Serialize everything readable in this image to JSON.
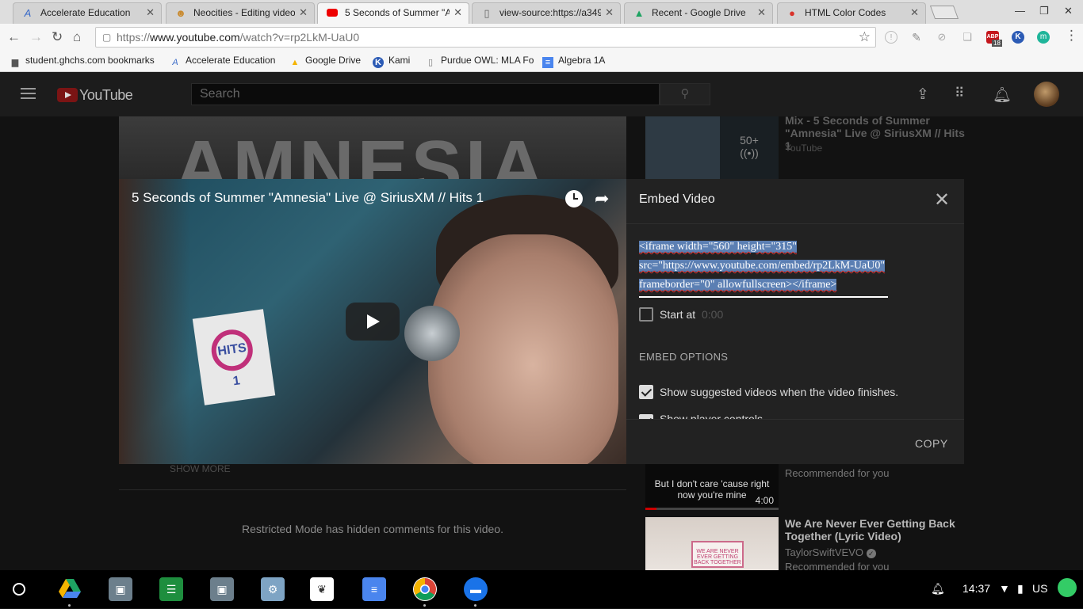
{
  "browser": {
    "tabs": [
      {
        "label": "Accelerate Education",
        "icon": "accelerate-icon",
        "active": false
      },
      {
        "label": "Neocities - Editing video",
        "icon": "cat-icon",
        "active": false
      },
      {
        "label": "5 Seconds of Summer \"A",
        "icon": "youtube-icon",
        "active": true
      },
      {
        "label": "view-source:https://a349",
        "icon": "page-icon",
        "active": false
      },
      {
        "label": "Recent - Google Drive",
        "icon": "drive-icon",
        "active": false
      },
      {
        "label": "HTML Color Codes",
        "icon": "color-codes-icon",
        "active": false
      }
    ],
    "url_prefix": "https://",
    "url_host": "www.youtube.com",
    "url_path": "/watch?v=rp2LkM-UaU0",
    "abp_count": "18",
    "bookmarks": [
      {
        "label": "student.ghchs.com bookmarks",
        "icon": "folder-icon"
      },
      {
        "label": "Accelerate Education",
        "icon": "accelerate-icon"
      },
      {
        "label": "Google Drive",
        "icon": "drive-icon"
      },
      {
        "label": "Kami",
        "icon": "kami-icon"
      },
      {
        "label": "Purdue OWL: MLA Fo",
        "icon": "page-icon"
      },
      {
        "label": "Algebra 1A",
        "icon": "docs-icon"
      }
    ]
  },
  "youtube": {
    "logo_text": "YouTube",
    "search_placeholder": "Search",
    "background_video_text": "AMNESIA",
    "sidebar_top": {
      "title": "Mix - 5 Seconds of Summer \"Amnesia\" Live @ SiriusXM // Hits 1",
      "channel": "YouTube",
      "count": "50+"
    },
    "player": {
      "title": "5 Seconds of Summer \"Amnesia\" Live @ SiriusXM // Hits 1",
      "mic_flag_text": "HITS 1"
    },
    "embed_panel": {
      "title": "Embed Video",
      "code_line1": "<iframe width=\"560\" height=\"315\"",
      "code_line2": "src=\"https://www.youtube.com/embed/rp2LkM-UaU0\"",
      "code_line3": "frameborder=\"0\" allowfullscreen></iframe>",
      "start_at_label": "Start at",
      "start_at_value": "0:00",
      "start_at_checked": false,
      "embed_options_heading": "EMBED OPTIONS",
      "option1_label": "Show suggested videos when the video finishes.",
      "option1_checked": true,
      "option2_label": "Show player controls.",
      "option2_checked": true,
      "copy_label": "COPY"
    },
    "show_more": "SHOW MORE",
    "restricted_text": "Restricted Mode has hidden comments for this video.",
    "sidebar_item2": {
      "thumb_text": "But I don't care 'cause right now you're mine",
      "duration": "4:00",
      "recommended": "Recommended for you"
    },
    "sidebar_item3": {
      "title": "We Are Never Ever Getting Back Together (Lyric Video)",
      "channel": "TaylorSwiftVEVO",
      "recommended": "Recommended for you",
      "thumb_text": "WE ARE NEVER EVER GETTING BACK TOGETHER"
    }
  },
  "taskbar": {
    "time": "14:37",
    "locale": "US"
  }
}
